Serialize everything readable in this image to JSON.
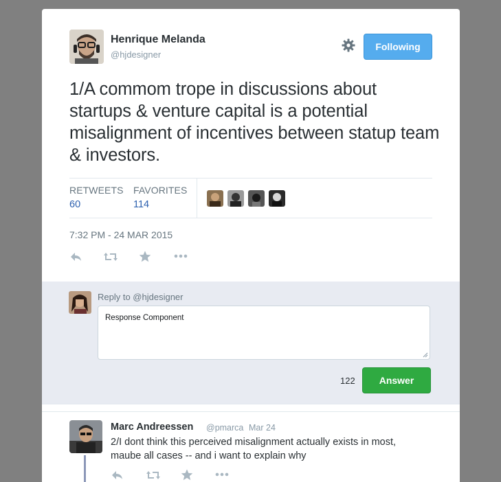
{
  "tweet": {
    "author_name": "Henrique Melanda",
    "author_handle": "@hjdesigner",
    "follow_label": "Following",
    "text": "1/A commom trope in discussions about startups & venture capital is a potential misalignment of incentives between statup team & investors.",
    "stats": {
      "retweets_label": "RETWEETS",
      "retweets_value": "60",
      "favorites_label": "FAVORITES",
      "favorites_value": "114"
    },
    "timestamp": "7:32 PM - 24 MAR 2015",
    "actions": [
      "reply-icon",
      "retweet-icon",
      "favorite-icon",
      "more-icon"
    ]
  },
  "reply_form": {
    "reply_to": "Reply to @hjdesigner",
    "value": "Response Component",
    "char_count": "122",
    "submit_label": "Answer"
  },
  "reply_tweet": {
    "author_name": "Marc Andreessen",
    "author_handle": "@pmarca",
    "date": "Mar 24",
    "text": "2/I dont think this perceived misalignment actually exists in most, maube all cases -- and i want to explain why"
  },
  "colors": {
    "follow_button": "#55acee",
    "answer_button": "#2faa41",
    "stat_value": "#2b5fae",
    "reply_area_bg": "#e8ebf2"
  }
}
